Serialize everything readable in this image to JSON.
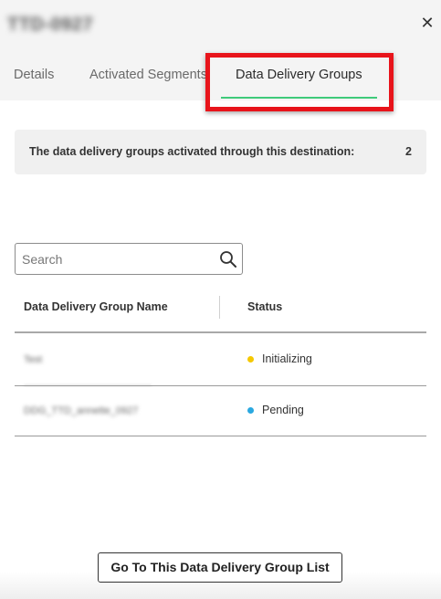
{
  "header": {
    "title": "TTD-0927",
    "close_glyph": "✕"
  },
  "tabs": [
    {
      "label": "Details",
      "active": false
    },
    {
      "label": "Activated Segments",
      "active": false
    },
    {
      "label": "Data Delivery Groups",
      "active": true
    }
  ],
  "summary": {
    "text": "The data delivery groups activated through this destination:",
    "count": "2"
  },
  "search": {
    "placeholder": "Search",
    "value": "",
    "icon": "search-icon"
  },
  "table": {
    "columns": [
      "Data Delivery Group Name",
      "Status"
    ],
    "rows": [
      {
        "name": "Test",
        "status": "Initializing",
        "status_color": "#f5c800"
      },
      {
        "name": "DDG_TTD_annette_0927",
        "status": "Pending",
        "status_color": "#2aa8e0"
      }
    ]
  },
  "footer": {
    "button_label": "Go To This Data Delivery Group List"
  },
  "colors": {
    "accent_underline": "#3fca7a",
    "highlight_box": "#e8141b"
  }
}
